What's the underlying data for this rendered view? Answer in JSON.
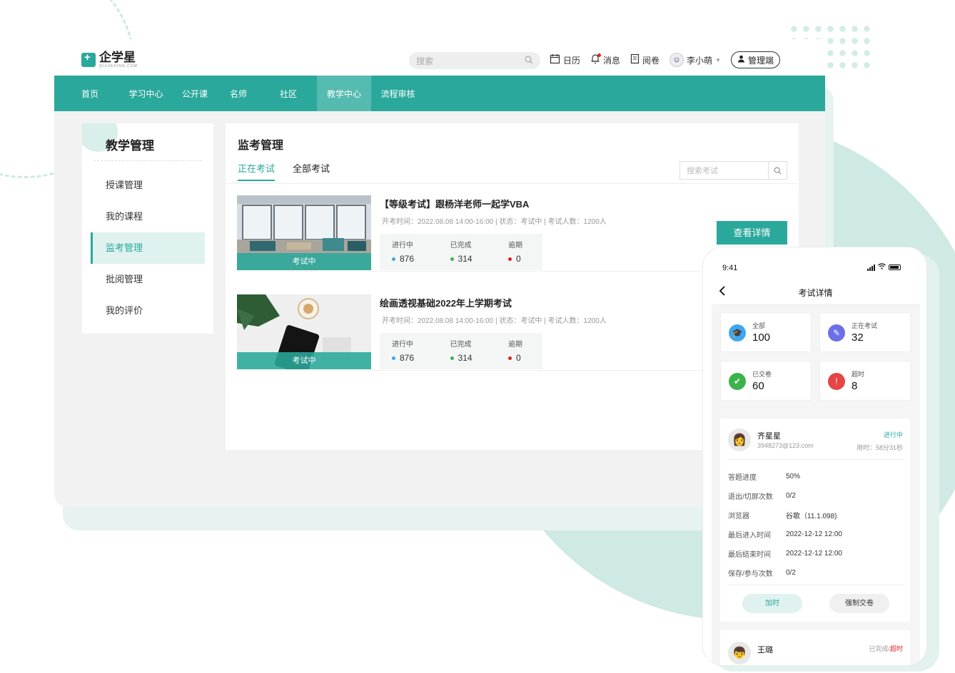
{
  "header": {
    "logo_text": "企学星",
    "logo_sub": "QIXUEXING.COM",
    "search_placeholder": "搜索",
    "tools": {
      "calendar": "日历",
      "messages": "消息",
      "grading": "阅卷"
    },
    "user_name": "李小萌",
    "admin_button": "管理端"
  },
  "nav": {
    "items": [
      "首页",
      "学习中心",
      "公开课",
      "名师",
      "社区",
      "教学中心",
      "流程审核"
    ],
    "active": "教学中心"
  },
  "sidebar": {
    "title": "教学管理",
    "items": [
      "授课管理",
      "我的课程",
      "监考管理",
      "批阅管理",
      "我的评价"
    ],
    "active": "监考管理"
  },
  "main": {
    "title": "监考管理",
    "tabs": [
      "正在考试",
      "全部考试"
    ],
    "active_tab": "正在考试",
    "search_placeholder": "搜索考试",
    "detail_button": "查看详情",
    "stat_labels": {
      "in_progress": "进行中",
      "completed": "已完成",
      "overdue": "逾期"
    },
    "exams": [
      {
        "title": "【等级考试】跟杨洋老师一起学VBA",
        "meta": "开考时间：2022.08.08 14:00-16:00 | 状态：考试中 | 考试人数：1200人",
        "badge": "考试中",
        "in_progress": "876",
        "completed": "314",
        "overdue": "0"
      },
      {
        "title": "绘画透视基础2022年上学期考试",
        "meta": "开考时间：2022.08.08 14:00-16:00 | 状态：考试中 | 考试人数：1200人",
        "badge": "考试中",
        "in_progress": "876",
        "completed": "314",
        "overdue": "0"
      }
    ]
  },
  "phone": {
    "time": "9:41",
    "title": "考试详情",
    "summary": [
      {
        "label": "全部",
        "value": "100",
        "icon": "graduation-cap-icon",
        "color": "#3fa6ef"
      },
      {
        "label": "正在考试",
        "value": "32",
        "icon": "pencil-icon",
        "color": "#6b6fe8"
      },
      {
        "label": "已交卷",
        "value": "60",
        "icon": "check-icon",
        "color": "#3cb34a"
      },
      {
        "label": "超时",
        "value": "8",
        "icon": "exclamation-icon",
        "color": "#e64545"
      }
    ],
    "person": {
      "name": "齐星星",
      "email": "3948273@123.com",
      "status": "进行中",
      "time_used": "用时：58分31秒",
      "rows": [
        {
          "k": "答题进度",
          "v": "50%"
        },
        {
          "k": "退出/切屏次数",
          "v": "0/2"
        },
        {
          "k": "浏览器",
          "v": "谷歌（11.1.098)"
        },
        {
          "k": "最后进入时间",
          "v": "2022-12-12 12:00"
        },
        {
          "k": "最后结束时间",
          "v": "2022-12-12 12:00"
        },
        {
          "k": "保存/参与次数",
          "v": "0/2"
        }
      ],
      "btn_add_time": "加时",
      "btn_force_submit": "强制交卷"
    },
    "person2": {
      "name": "王璐",
      "status_done": "已完成/",
      "status_late": "超时"
    }
  },
  "colors": {
    "brand": "#2aa89b",
    "dot_in_progress": "#3fa6ef",
    "dot_completed": "#3cb34a",
    "dot_overdue": "#e02020"
  }
}
